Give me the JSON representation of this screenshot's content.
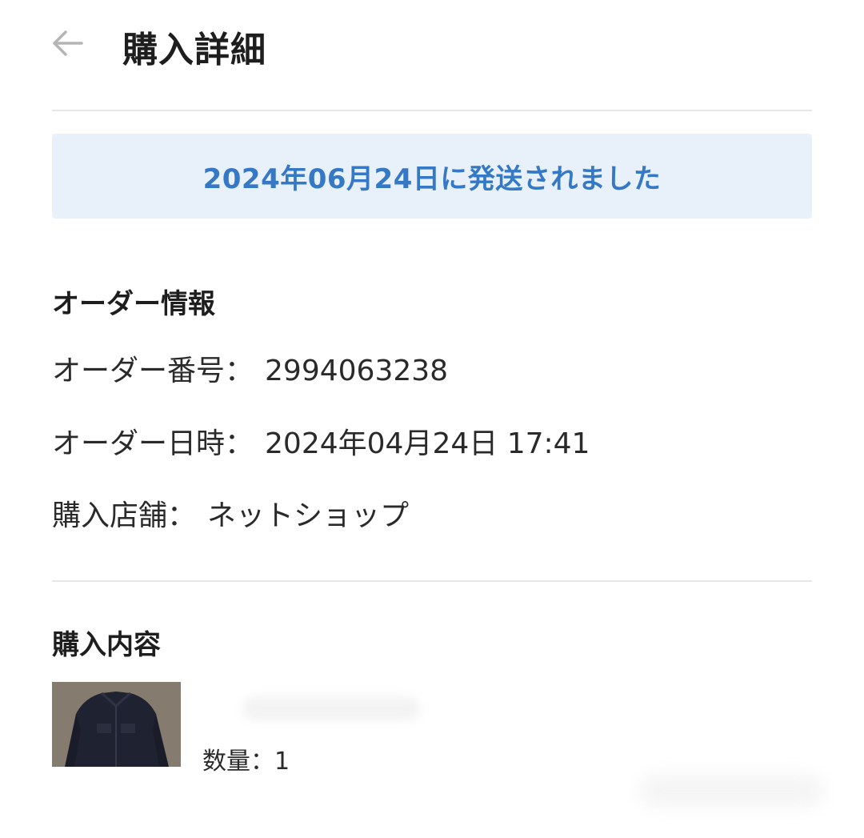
{
  "header": {
    "title": "購入詳細",
    "back_icon": "arrow-left-icon"
  },
  "status": {
    "message": "2024年06月24日に発送されました",
    "color": "#3478c6",
    "background": "#e8f0f9"
  },
  "order_info": {
    "section_title": "オーダー情報",
    "rows": [
      {
        "label": "オーダー番号：",
        "value": "2994063238"
      },
      {
        "label": "オーダー日時：",
        "value": "2024年04月24日 17:41"
      },
      {
        "label": "購入店舗：",
        "value": "ネットショップ"
      }
    ]
  },
  "purchase": {
    "section_title": "購入内容",
    "items": [
      {
        "image": "denim-jacket-photo",
        "quantity_label": "数量：",
        "quantity": "1"
      }
    ]
  }
}
